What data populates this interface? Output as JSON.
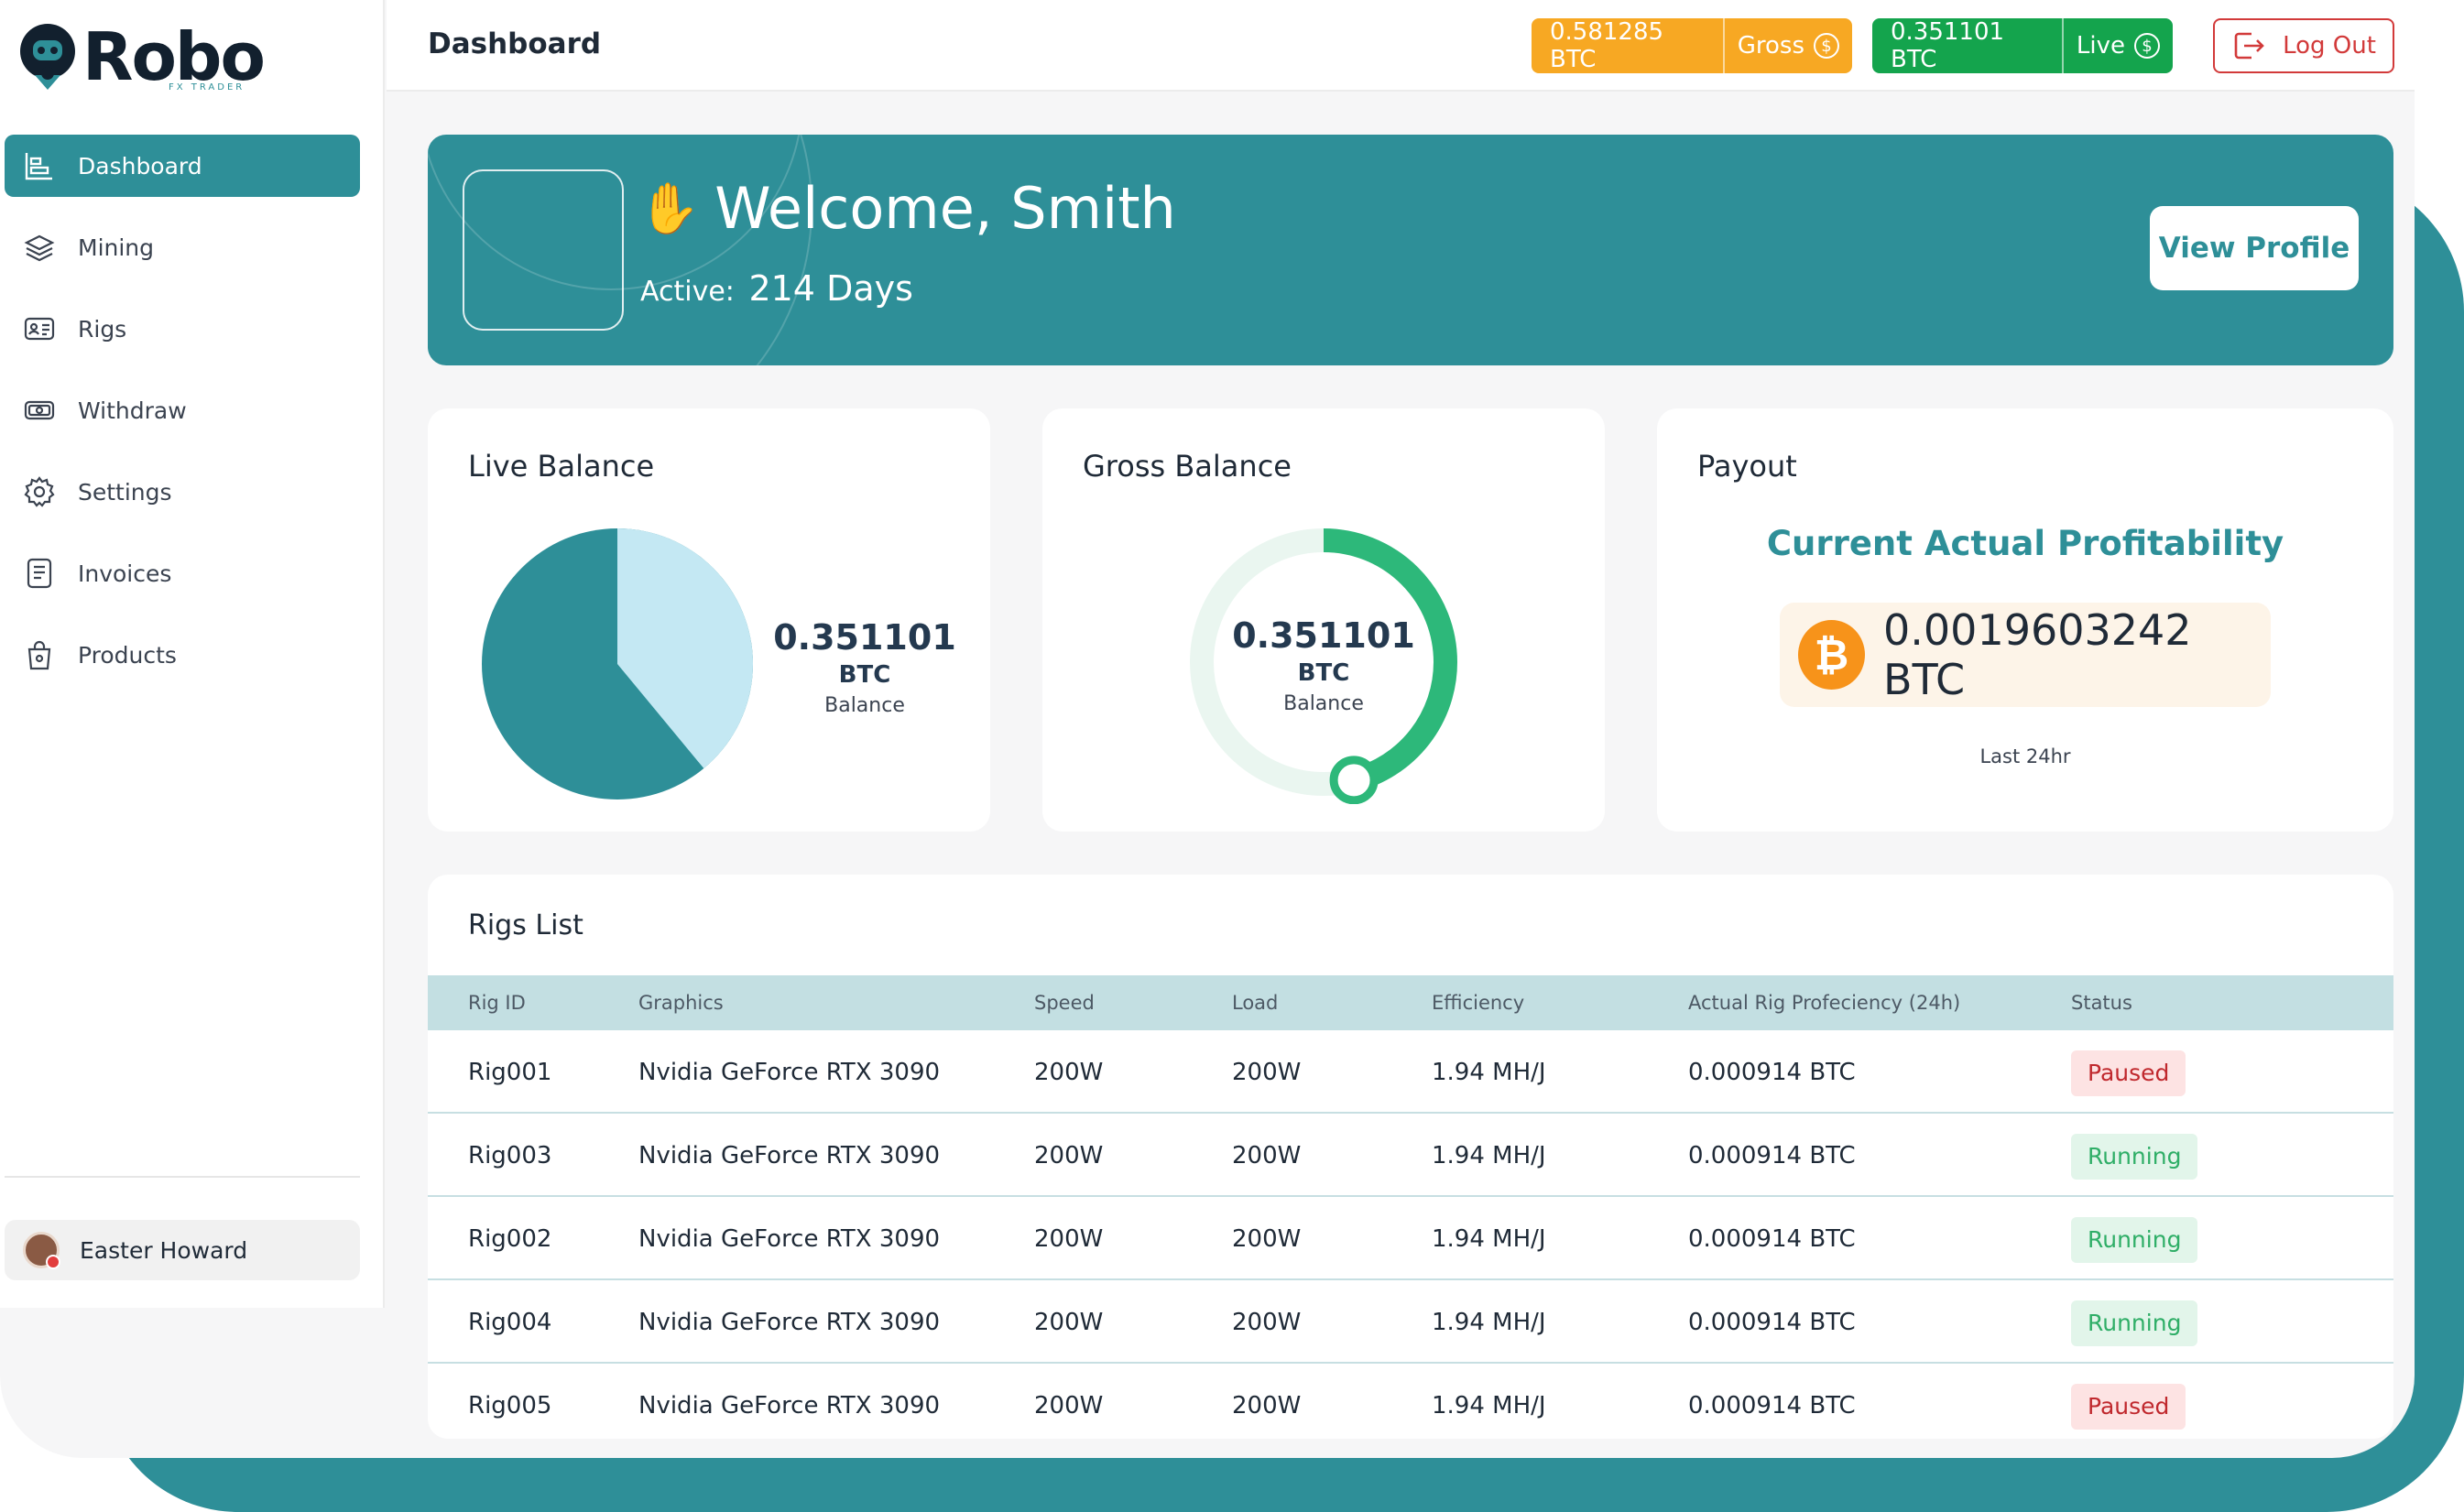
{
  "brand": {
    "name": "Robo",
    "tagline": "FX TRADER"
  },
  "sidebar": {
    "items": [
      {
        "label": "Dashboard",
        "icon": "chart-icon",
        "active": true
      },
      {
        "label": "Mining",
        "icon": "layers-icon",
        "active": false
      },
      {
        "label": "Rigs",
        "icon": "id-card-icon",
        "active": false
      },
      {
        "label": "Withdraw",
        "icon": "cash-icon",
        "active": false
      },
      {
        "label": "Settings",
        "icon": "gear-icon",
        "active": false
      },
      {
        "label": "Invoices",
        "icon": "invoice-icon",
        "active": false
      },
      {
        "label": "Products",
        "icon": "bag-icon",
        "active": false
      }
    ],
    "user_name": "Easter Howard"
  },
  "header": {
    "title": "Dashboard",
    "gross_amount": "0.581285 BTC",
    "gross_label": "Gross",
    "live_amount": "0.351101 BTC",
    "live_label": "Live",
    "logout_label": "Log Out",
    "colors": {
      "gross": "#f7a823",
      "live": "#14a44d",
      "logout": "#d23a3a"
    }
  },
  "banner": {
    "welcome": "Welcome, Smith",
    "wave_icon": "waving-hand-icon",
    "active_label": "Active:",
    "active_days": "214 Days",
    "view_profile_label": "View Profile",
    "color": "#2e8f98"
  },
  "live_balance": {
    "title": "Live Balance",
    "value": "0.351101",
    "unit": "BTC",
    "label": "Balance",
    "pie_fraction": 0.39,
    "colors": {
      "filled": "#2e8f98",
      "remaining": "#c4e8f3"
    }
  },
  "gross_balance": {
    "title": "Gross Balance",
    "value": "0.351101",
    "unit": "BTC",
    "label": "Balance",
    "progress_fraction": 0.46,
    "colors": {
      "progress": "#2db87a",
      "track": "#eaf6f0"
    }
  },
  "payout": {
    "title": "Payout",
    "subtitle": "Current Actual Profitability",
    "amount": "0.0019603242 BTC",
    "coin_symbol": "₿",
    "period": "Last 24hr"
  },
  "rigs": {
    "title": "Rigs List",
    "columns": [
      "Rig ID",
      "Graphics",
      "Speed",
      "Load",
      "Efficiency",
      "Actual Rig Profeciency (24h)",
      "Status"
    ],
    "rows": [
      {
        "id": "Rig001",
        "graphics": "Nvidia GeForce RTX 3090",
        "speed": "200W",
        "load": "200W",
        "efficiency": "1.94 MH/J",
        "proficiency": "0.000914 BTC",
        "status": "Paused"
      },
      {
        "id": "Rig003",
        "graphics": "Nvidia GeForce RTX 3090",
        "speed": "200W",
        "load": "200W",
        "efficiency": "1.94 MH/J",
        "proficiency": "0.000914 BTC",
        "status": "Running"
      },
      {
        "id": "Rig002",
        "graphics": "Nvidia GeForce RTX 3090",
        "speed": "200W",
        "load": "200W",
        "efficiency": "1.94 MH/J",
        "proficiency": "0.000914 BTC",
        "status": "Running"
      },
      {
        "id": "Rig004",
        "graphics": "Nvidia GeForce RTX 3090",
        "speed": "200W",
        "load": "200W",
        "efficiency": "1.94 MH/J",
        "proficiency": "0.000914 BTC",
        "status": "Running"
      },
      {
        "id": "Rig005",
        "graphics": "Nvidia GeForce RTX 3090",
        "speed": "200W",
        "load": "200W",
        "efficiency": "1.94 MH/J",
        "proficiency": "0.000914 BTC",
        "status": "Paused"
      }
    ]
  }
}
